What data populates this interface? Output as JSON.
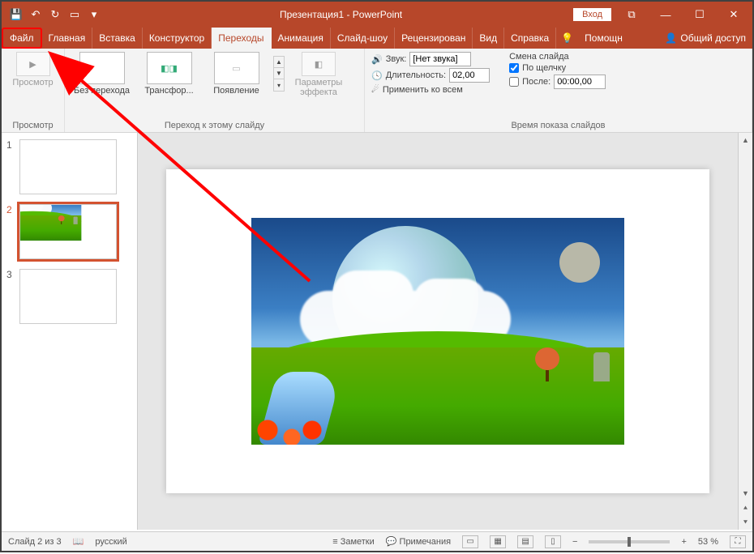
{
  "title": "Презентация1 - PowerPoint",
  "login_label": "Вход",
  "tabs": {
    "file": "Файл",
    "home": "Главная",
    "insert": "Вставка",
    "design": "Конструктор",
    "transitions": "Переходы",
    "animations": "Анимация",
    "slideshow": "Слайд-шоу",
    "review": "Рецензирован",
    "view": "Вид",
    "help": "Справка",
    "tellme": "Помощн",
    "share": "Общий доступ"
  },
  "ribbon": {
    "preview_btn": "Просмотр",
    "preview_grp": "Просмотр",
    "gal": {
      "none": "Без перехода",
      "morph": "Трансфор...",
      "fade": "Появление"
    },
    "effect_options": "Параметры эффекта",
    "transition_grp": "Переход к этому слайду",
    "sound_label": "Звук:",
    "sound_value": "[Нет звука]",
    "duration_label": "Длительность:",
    "duration_value": "02,00",
    "apply_all": "Применить ко всем",
    "advance_label": "Смена слайда",
    "on_click": "По щелчку",
    "after": "После:",
    "after_value": "00:00,00",
    "timing_grp": "Время показа слайдов"
  },
  "slides": [
    "1",
    "2",
    "3"
  ],
  "status": {
    "slide_pos": "Слайд 2 из 3",
    "lang": "русский",
    "notes": "Заметки",
    "comments": "Примечания",
    "zoom": "53 %"
  }
}
